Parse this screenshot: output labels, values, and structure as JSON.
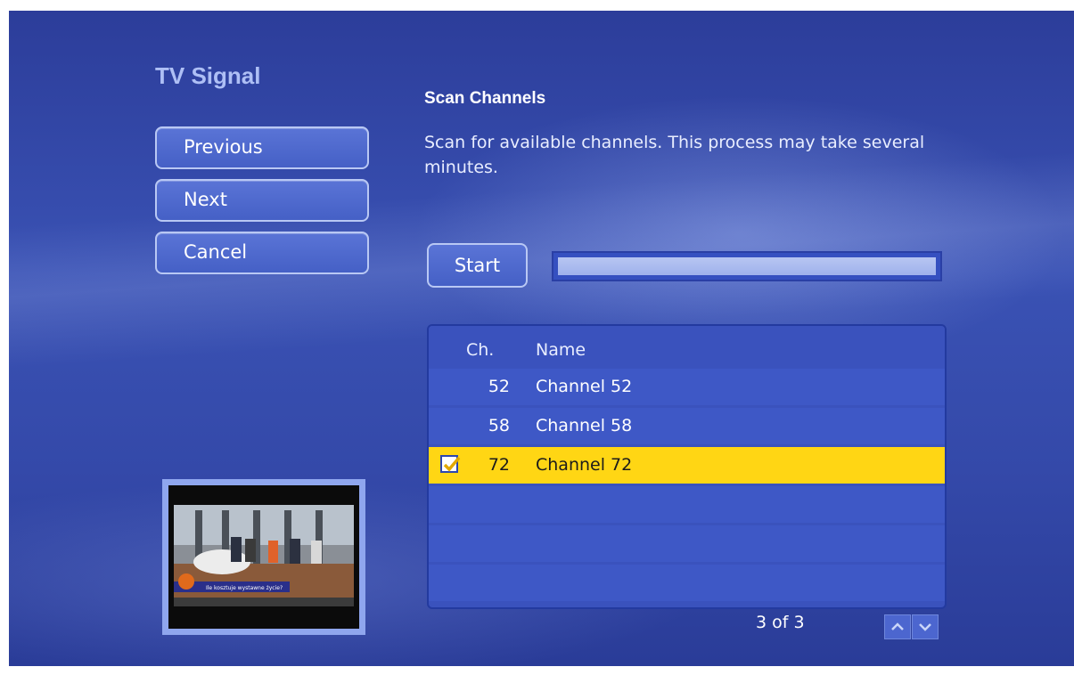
{
  "header": {
    "title": "TV Signal"
  },
  "nav": {
    "previous_label": "Previous",
    "next_label": "Next",
    "cancel_label": "Cancel"
  },
  "scan": {
    "title": "Scan Channels",
    "description": "Scan for available channels. This process may take several minutes.",
    "start_label": "Start",
    "progress": 1.0
  },
  "channel_list": {
    "headers": {
      "channel": "Ch.",
      "name": "Name"
    },
    "rows": [
      {
        "ch": "52",
        "name": "Channel 52",
        "checked": false,
        "selected": false
      },
      {
        "ch": "58",
        "name": "Channel 58",
        "checked": false,
        "selected": false
      },
      {
        "ch": "72",
        "name": "Channel 72",
        "checked": true,
        "selected": true
      }
    ],
    "page_count": "3 of 3"
  },
  "preview": {
    "caption": "Ile kosztuje wystawne życie?"
  },
  "icons": {
    "checkbox": "checkmark-icon",
    "scroll_up": "chevron-up-icon",
    "scroll_down": "chevron-down-icon"
  },
  "colors": {
    "accent_selected": "#ffd614",
    "title": "#aebff5",
    "background": "#3449a9"
  }
}
